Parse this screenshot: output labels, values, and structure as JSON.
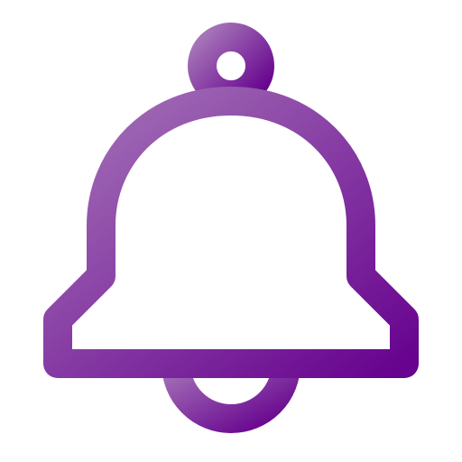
{
  "icon": {
    "name": "bell-icon",
    "style": "outline",
    "colors": {
      "gradient_start": "#a574b8",
      "gradient_end": "#67038f",
      "fill": "#ffffff"
    }
  }
}
